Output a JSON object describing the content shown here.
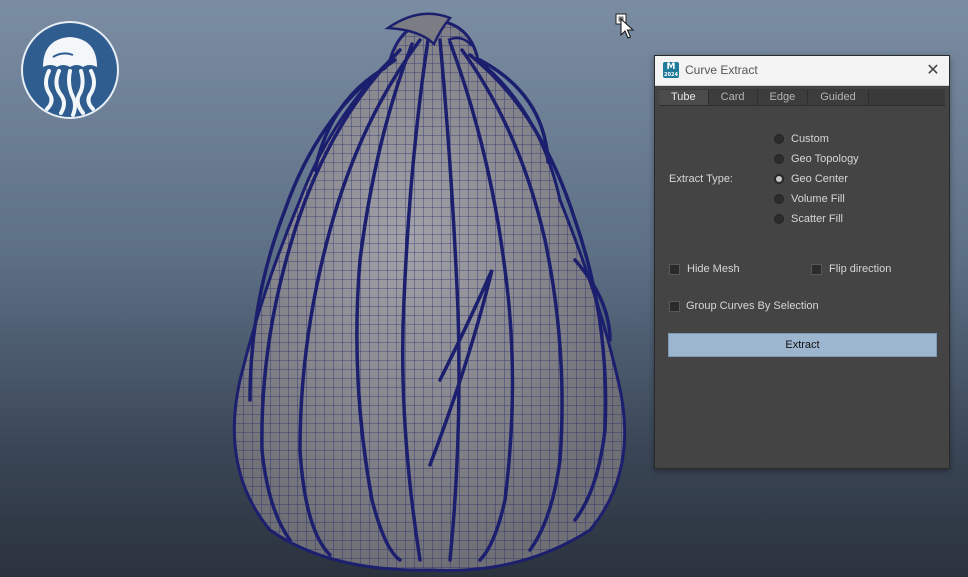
{
  "window": {
    "title": "Curve Extract",
    "app_icon": "maya-app-icon",
    "close_icon": "close-icon"
  },
  "tabs": [
    {
      "label": "Tube",
      "active": true
    },
    {
      "label": "Card",
      "active": false
    },
    {
      "label": "Edge",
      "active": false
    },
    {
      "label": "Guided",
      "active": false
    }
  ],
  "extract_type": {
    "label": "Extract Type:",
    "options": [
      {
        "label": "Custom",
        "selected": false
      },
      {
        "label": "Geo Topology",
        "selected": false
      },
      {
        "label": "Geo Center",
        "selected": true
      },
      {
        "label": "Volume Fill",
        "selected": false
      },
      {
        "label": "Scatter Fill",
        "selected": false
      }
    ]
  },
  "options": {
    "hide_mesh": {
      "label": "Hide Mesh",
      "checked": false
    },
    "flip_direction": {
      "label": "Flip direction",
      "checked": false
    },
    "group_curves": {
      "label": "Group Curves By Selection",
      "checked": false
    }
  },
  "extract_button": {
    "label": "Extract"
  },
  "colors": {
    "panel_bg": "#444444",
    "button_accent": "#9db6cf",
    "wireframe": "#1c1f6e",
    "mesh": "#8f8f95",
    "logo": "#2f5d8f"
  },
  "viewport": {
    "logo_icon": "jellyfish-logo-icon",
    "cursor_icon": "mouse-cursor-icon",
    "model": "gourd-mesh-with-curves"
  }
}
